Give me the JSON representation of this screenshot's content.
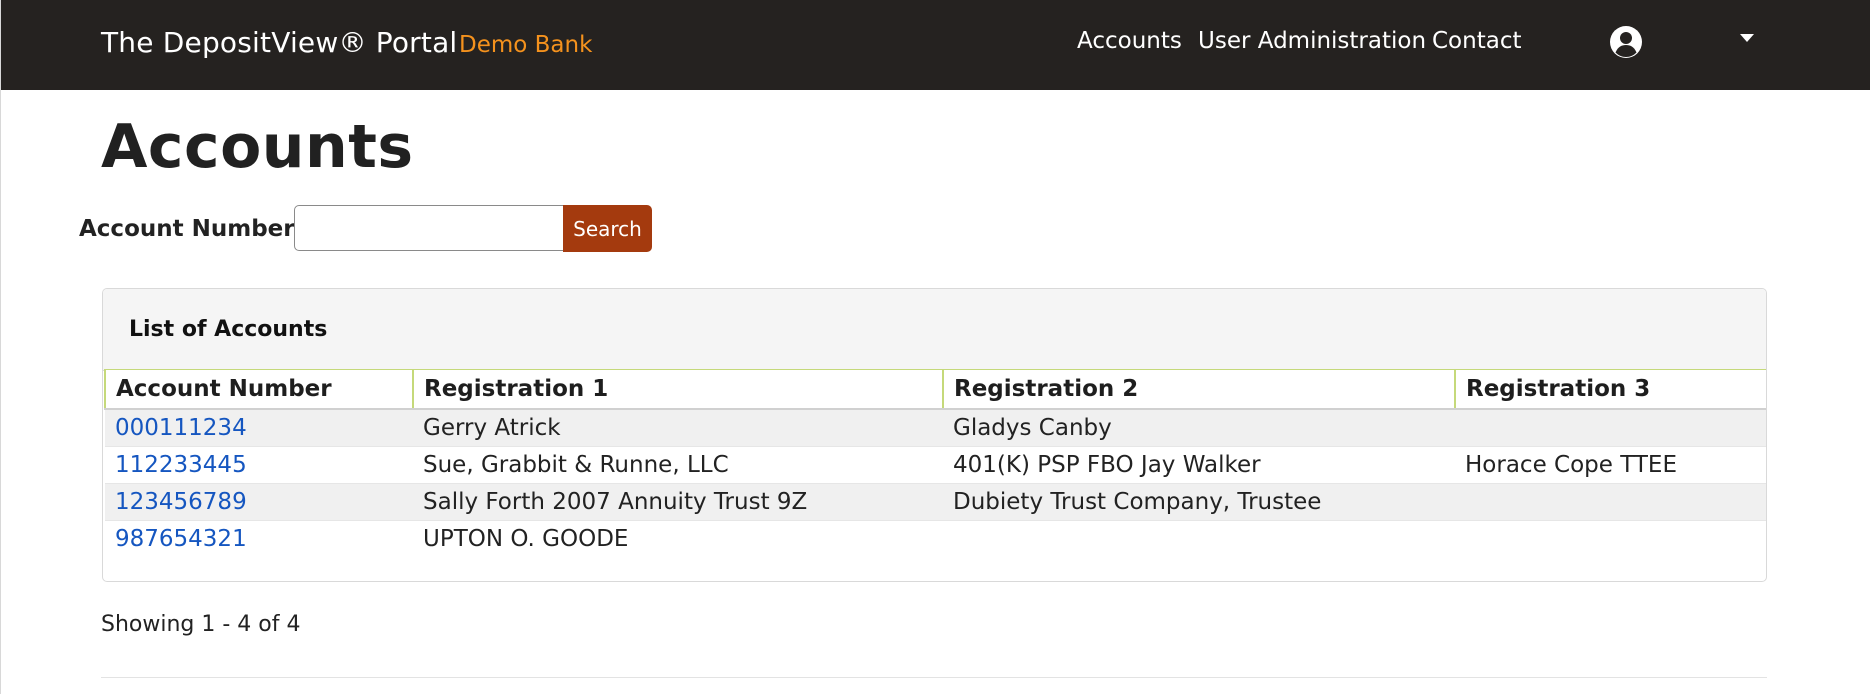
{
  "navbar": {
    "brand": "The DepositView® Portal",
    "bank_name": "Demo Bank",
    "links": {
      "accounts": "Accounts",
      "user_administration": "User Administration",
      "contact": "Contact"
    },
    "icons": {
      "user": "user-circle-icon",
      "menu": "caret-down-icon"
    },
    "colors": {
      "background": "#252220",
      "bank_name": "#f5921d"
    }
  },
  "page": {
    "title": "Accounts"
  },
  "search": {
    "label": "Account Number",
    "value": "",
    "placeholder": "",
    "button_label": "Search",
    "button_color": "#a43a0e"
  },
  "accounts_card": {
    "title": "List of Accounts",
    "columns": [
      "Account Number",
      "Registration 1",
      "Registration 2",
      "Registration 3"
    ],
    "rows": [
      [
        "000111234",
        "Gerry Atrick",
        "Gladys Canby",
        ""
      ],
      [
        "112233445",
        "Sue, Grabbit & Runne, LLC",
        "401(K) PSP FBO Jay Walker",
        "Horace Cope TTEE"
      ],
      [
        "123456789",
        "Sally Forth 2007 Annuity Trust 9Z",
        "Dubiety Trust Company, Trustee",
        ""
      ],
      [
        "987654321",
        "UPTON O. GOODE",
        "",
        ""
      ]
    ],
    "link_color": "#1556c0"
  },
  "pagination": {
    "summary": "Showing 1 - 4 of 4"
  }
}
